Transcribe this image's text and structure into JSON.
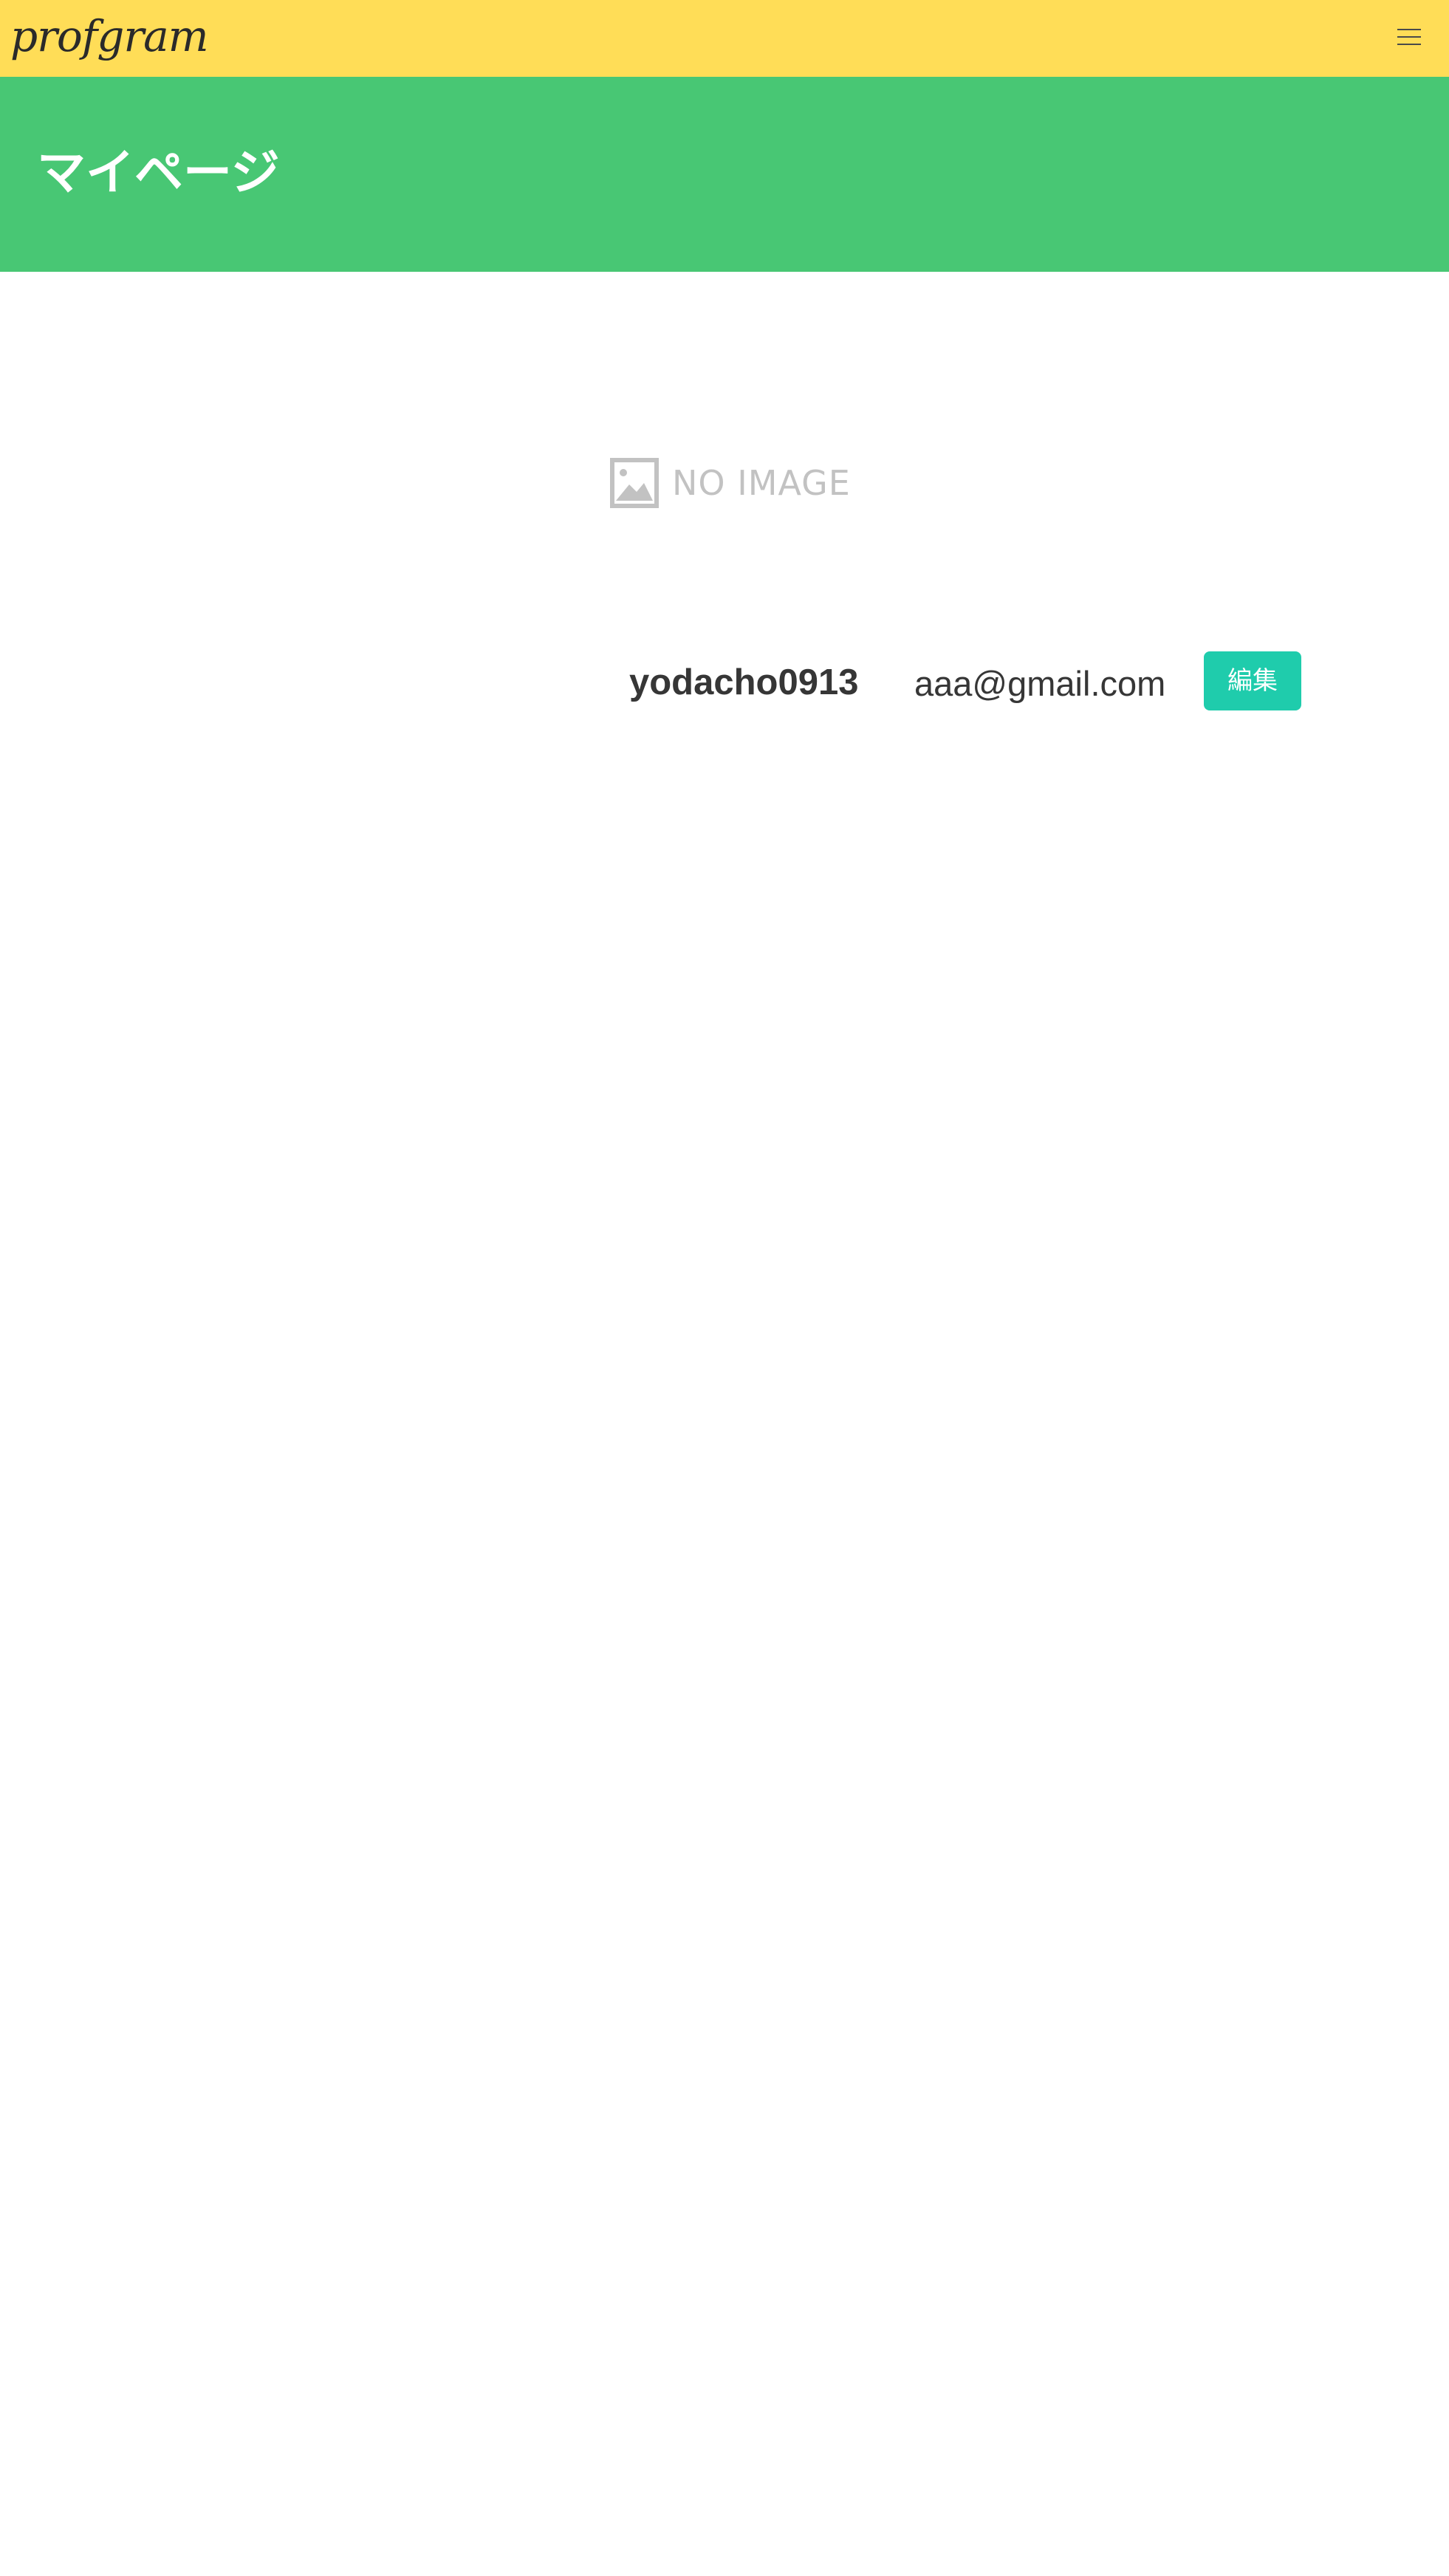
{
  "navbar": {
    "brand": "profgram",
    "menu_icon": "hamburger-menu-icon",
    "background": "#ffdd57"
  },
  "hero": {
    "title": "マイページ",
    "background": "#48c774"
  },
  "profile": {
    "image_placeholder": {
      "icon": "image-icon",
      "text": "NO IMAGE"
    },
    "username": "yodacho0913",
    "email": "aaa@gmail.com",
    "edit_label": "編集",
    "edit_color": "#1fccac"
  }
}
